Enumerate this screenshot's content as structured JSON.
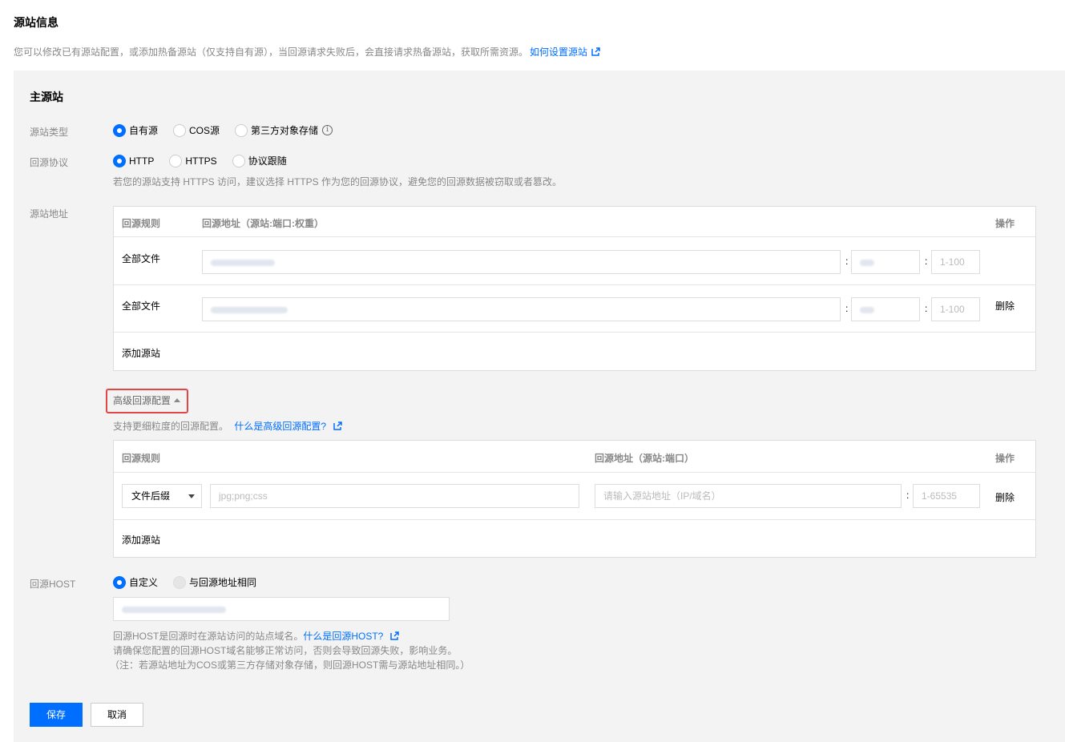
{
  "header": {
    "title": "源站信息",
    "description": "您可以修改已有源站配置，或添加热备源站（仅支持自有源），当回源请求失败后，会直接请求热备源站，获取所需资源。",
    "help_link": "如何设置源站"
  },
  "primary": {
    "title": "主源站",
    "origin_type": {
      "label": "源站类型",
      "options": [
        "自有源",
        "COS源",
        "第三方对象存储"
      ],
      "selected": "自有源"
    },
    "protocol": {
      "label": "回源协议",
      "options": [
        "HTTP",
        "HTTPS",
        "协议跟随"
      ],
      "selected": "HTTP",
      "hint": "若您的源站支持 HTTPS 访问，建议选择 HTTPS 作为您的回源协议，避免您的回源数据被窃取或者篡改。"
    },
    "address": {
      "label": "源站地址",
      "columns": [
        "回源规则",
        "回源地址（源站:端口:权重）",
        "操作"
      ],
      "rows": [
        {
          "rule": "全部文件",
          "address": "",
          "port": "",
          "weight_placeholder": "1-100",
          "action": ""
        },
        {
          "rule": "全部文件",
          "address": "",
          "port": "",
          "weight_placeholder": "1-100",
          "action": "删除"
        }
      ],
      "add_label": "添加源站",
      "colon": ":"
    }
  },
  "advanced": {
    "toggle_label": "高级回源配置",
    "hint": "支持更细粒度的回源配置。",
    "help_link": "什么是高级回源配置?",
    "columns": [
      "回源规则",
      "回源地址（源站:端口）",
      "操作"
    ],
    "rows": [
      {
        "rule_type": "文件后缀",
        "rule_placeholder": "jpg;png;css",
        "address_placeholder": "请输入源站地址（IP/域名）",
        "port_placeholder": "1-65535",
        "action": "删除"
      }
    ],
    "add_label": "添加源站"
  },
  "host": {
    "label": "回源HOST",
    "options": [
      "自定义",
      "与回源地址相同"
    ],
    "selected": "自定义",
    "value": "",
    "hint_line1": "回源HOST是回源时在源站访问的站点域名。",
    "help_link": "什么是回源HOST?",
    "hint_line2": "请确保您配置的回源HOST域名能够正常访问，否则会导致回源失败，影响业务。",
    "hint_line3": "（注：若源站地址为COS或第三方存储对象存储，则回源HOST需与源站地址相同。）"
  },
  "buttons": {
    "save": "保存",
    "cancel": "取消"
  },
  "colors": {
    "accent": "#006eff",
    "highlight_border": "#e54545",
    "panel_bg": "#f3f3f3"
  }
}
